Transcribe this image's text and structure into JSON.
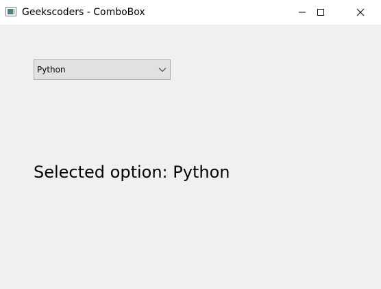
{
  "window": {
    "title": "Geekscoders - ComboBox",
    "icon": "app-window-icon",
    "controls": [
      "minimize-icon",
      "maximize-icon",
      "close-icon"
    ]
  },
  "combobox": {
    "value": "Python",
    "arrow_icon": "chevron-down-icon"
  },
  "label": {
    "text": "Selected option: Python"
  },
  "colors": {
    "window_bg": "#f0f0f0",
    "titlebar_bg": "#ffffff",
    "combo_bg": "#e1e1e1",
    "combo_border": "#adadad"
  }
}
